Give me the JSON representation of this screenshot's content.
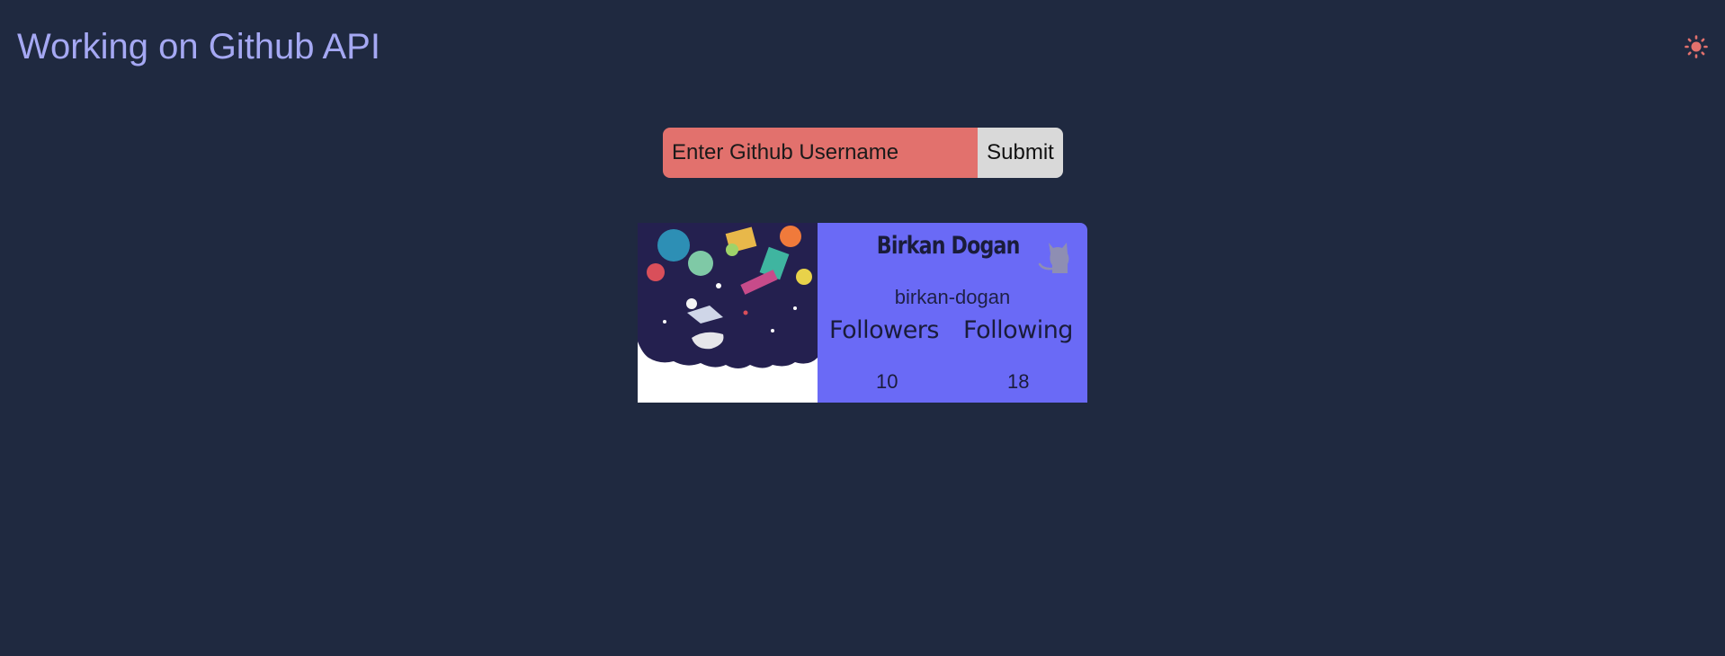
{
  "header": {
    "title": "Working on Github API",
    "theme_toggle_icon": "sun-icon",
    "theme_toggle_color": "#e2716d"
  },
  "search": {
    "placeholder": "Enter Github Username",
    "value": "",
    "submit_label": "Submit"
  },
  "profile": {
    "name": "Birkan Dogan",
    "login": "birkan-dogan",
    "followers_label": "Followers",
    "following_label": "Following",
    "followers": "10",
    "following": "18",
    "avatar_icon": "avatar-image",
    "brand_icon": "github-octocat-icon"
  },
  "colors": {
    "background": "#1f2940",
    "title": "#a5a8f3",
    "input_bg": "#e2716d",
    "button_bg": "#d9d9d9",
    "card_bg": "#6a6af6"
  }
}
